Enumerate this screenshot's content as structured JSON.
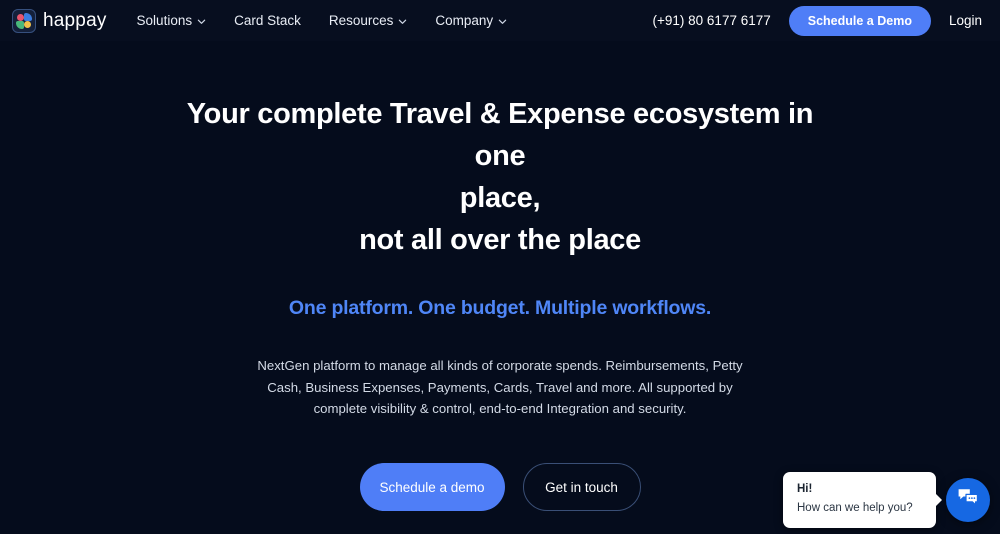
{
  "brand": {
    "name": "happay",
    "logo_icon": "happay-squares-logo",
    "colors": {
      "dot_red": "#e8556d",
      "dot_blue": "#3b7de0",
      "dot_green": "#49b87c",
      "dot_yellow": "#f0c04a"
    }
  },
  "nav": {
    "links": [
      {
        "label": "Solutions",
        "has_caret": true
      },
      {
        "label": "Card Stack",
        "has_caret": false
      },
      {
        "label": "Resources",
        "has_caret": true
      },
      {
        "label": "Company",
        "has_caret": true
      }
    ],
    "phone": "(+91) 80 6177 6177",
    "cta_label": "Schedule a Demo",
    "login_label": "Login"
  },
  "hero": {
    "title_line1": "Your complete Travel & Expense ecosystem in one",
    "title_line2": "place,",
    "title_line3": "not all over the place",
    "subtitle": "One platform. One budget. Multiple workflows.",
    "paragraph_line1": "NextGen platform to manage all kinds of corporate spends. Reimbursements,",
    "paragraph_line2": "Petty Cash, Business Expenses, Payments, Cards, Travel and more. All",
    "paragraph_line3": "supported by complete visibility & control, end-to-end Integration and security.",
    "primary_cta": "Schedule a demo",
    "secondary_cta": "Get in touch",
    "accent_color": "#4f86f7",
    "button_color": "#4f7ef7"
  },
  "chat": {
    "greeting": "Hi!",
    "prompt": "How can we help you?",
    "fab_icon": "chat-bubbles-icon",
    "fab_color": "#1668e3"
  },
  "theme": {
    "background": "#050c1c",
    "navbar_background": "#070e1f"
  }
}
